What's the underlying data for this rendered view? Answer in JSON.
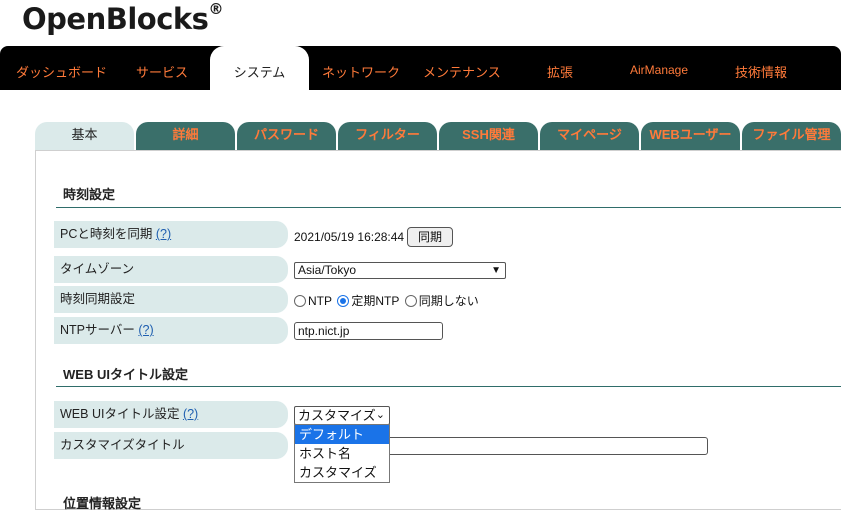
{
  "brand": {
    "name": "OpenBlocks",
    "reg": "®"
  },
  "topnav": {
    "items": [
      "ダッシュボード",
      "サービス",
      "システム",
      "ネットワーク",
      "メンテナンス",
      "拡張",
      "AirManage",
      "技術情報"
    ],
    "active": "システム"
  },
  "subtabs": {
    "items": [
      "基本",
      "詳細",
      "パスワード",
      "フィルター",
      "SSH関連",
      "マイページ",
      "WEBユーザー",
      "ファイル管理"
    ],
    "active": "基本"
  },
  "sections": {
    "time": "時刻設定",
    "webui": "WEB UIタイトル設定",
    "location": "位置情報設定"
  },
  "time_settings": {
    "pc_sync_label": "PCと時刻を同期",
    "help": "(?)",
    "current_time": "2021/05/19 16:28:44",
    "sync_button": "同期",
    "timezone_label": "タイムゾーン",
    "timezone_value": "Asia/Tokyo",
    "sync_setting_label": "時刻同期設定",
    "sync_options": [
      "NTP",
      "定期NTP",
      "同期しない"
    ],
    "sync_selected": "定期NTP",
    "ntp_server_label": "NTPサーバー",
    "ntp_server_value": "ntp.nict.jp"
  },
  "webui_settings": {
    "title_label": "WEB UIタイトル設定",
    "help": "(?)",
    "title_mode_value": "カスタマイズ",
    "title_mode_options": [
      "デフォルト",
      "ホスト名",
      "カスタマイズ"
    ],
    "title_mode_highlighted": "デフォルト",
    "custom_title_label": "カスタマイズタイトル",
    "custom_title_value": ""
  },
  "colors": {
    "nav_bg": "#000000",
    "nav_text": "#ff7a3a",
    "tab_bg": "#3a6f6a",
    "label_bg": "#dbeaea",
    "accent": "#1a73e8"
  }
}
